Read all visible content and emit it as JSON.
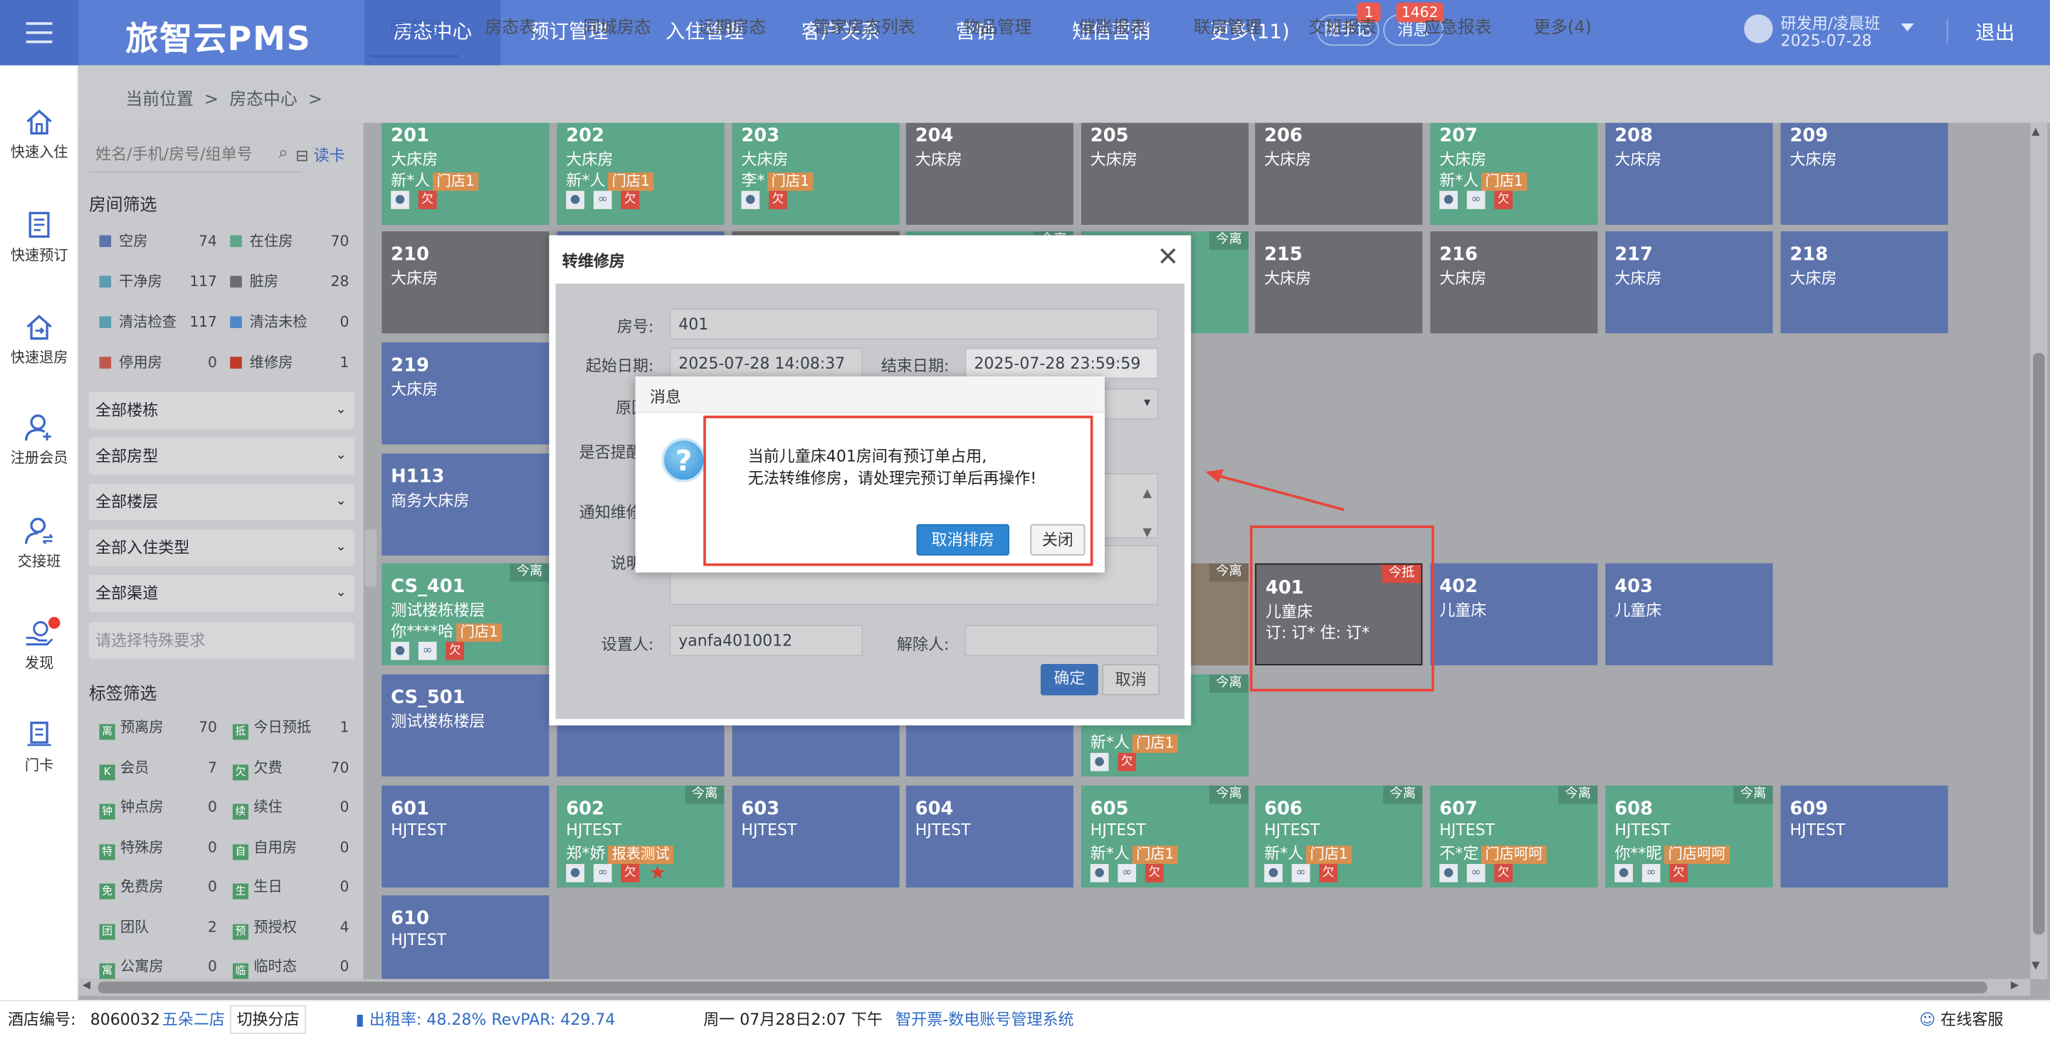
{
  "app": {
    "title": "旅智云PMS"
  },
  "topnav": {
    "items": [
      "房态中心",
      "预订管理",
      "入住管理",
      "客户关系",
      "营销",
      "短信营销",
      "更多(11)"
    ],
    "notes_label": "随手记",
    "notes_count": "1",
    "msg_label": "消息",
    "msg_count": "1462",
    "user_name": "研发用/凌晨班",
    "user_date": "2025-07-28",
    "logout": "退出"
  },
  "leftnav": [
    "快速入住",
    "快速预订",
    "快速退房",
    "注册会员",
    "交接班",
    "发现",
    "门卡"
  ],
  "breadcrumb": {
    "label": "当前位置",
    "sep": ">",
    "item": "房态中心",
    "sep2": ">"
  },
  "subtabs": [
    "房态图",
    "房态表",
    "同城房态",
    "远期房态",
    "管家房态列表",
    "物品管理",
    "催账报表",
    "联房管理",
    "交班报表",
    "应急报表",
    "更多(4)"
  ],
  "filter": {
    "search_placeholder": "姓名/手机/房号/组单号",
    "read_card": "读卡",
    "room_filter_title": "房间筛选",
    "status": [
      {
        "label": "空房",
        "count": "74",
        "color": "#5c73ac"
      },
      {
        "label": "在住房",
        "count": "70",
        "color": "#5ca689"
      },
      {
        "label": "干净房",
        "count": "117",
        "color": "#5c9bb0"
      },
      {
        "label": "脏房",
        "count": "28",
        "color": "#6b6d72"
      },
      {
        "label": "清洁检查",
        "count": "117",
        "color": "#5c9bb0"
      },
      {
        "label": "清洁未检",
        "count": "0",
        "color": "#4f86c6"
      },
      {
        "label": "停用房",
        "count": "0",
        "color": "#c0574e"
      },
      {
        "label": "维修房",
        "count": "1",
        "color": "#c0392b"
      }
    ],
    "dropdowns": [
      "全部楼栋",
      "全部房型",
      "全部楼层",
      "全部入住类型",
      "全部渠道"
    ],
    "special_placeholder": "请选择特殊要求",
    "tag_title": "标签筛选",
    "tags": [
      {
        "icon": "离",
        "label": "预离房",
        "count": "70"
      },
      {
        "icon": "抵",
        "label": "今日预抵",
        "count": "1"
      },
      {
        "icon": "K",
        "label": "会员",
        "count": "7"
      },
      {
        "icon": "欠",
        "label": "欠费",
        "count": "70"
      },
      {
        "icon": "钟",
        "label": "钟点房",
        "count": "0"
      },
      {
        "icon": "续",
        "label": "续住",
        "count": "0"
      },
      {
        "icon": "特",
        "label": "特殊房",
        "count": "0"
      },
      {
        "icon": "自",
        "label": "自用房",
        "count": "0"
      },
      {
        "icon": "免",
        "label": "免费房",
        "count": "0"
      },
      {
        "icon": "生",
        "label": "生日",
        "count": "0"
      },
      {
        "icon": "团",
        "label": "团队",
        "count": "2"
      },
      {
        "icon": "预",
        "label": "预授权",
        "count": "4"
      },
      {
        "icon": "寓",
        "label": "公寓房",
        "count": "0"
      },
      {
        "icon": "临",
        "label": "临时态",
        "count": "0"
      }
    ]
  },
  "rooms": [
    {
      "no": "201",
      "type": "大床房",
      "guest": "新*人",
      "store": "门店1",
      "color": "g",
      "icons": "p|o",
      "badge": ""
    },
    {
      "no": "202",
      "type": "大床房",
      "guest": "新*人",
      "store": "门店1",
      "color": "g",
      "icons": "p|l|o",
      "badge": ""
    },
    {
      "no": "203",
      "type": "大床房",
      "guest": "李*",
      "store": "门店1",
      "color": "g",
      "icons": "p|o",
      "badge": ""
    },
    {
      "no": "204",
      "type": "大床房",
      "guest": "",
      "store": "",
      "color": "d",
      "icons": "",
      "badge": ""
    },
    {
      "no": "205",
      "type": "大床房",
      "guest": "",
      "store": "",
      "color": "d",
      "icons": "",
      "badge": ""
    },
    {
      "no": "206",
      "type": "大床房",
      "guest": "",
      "store": "",
      "color": "d",
      "icons": "",
      "badge": ""
    },
    {
      "no": "207",
      "type": "大床房",
      "guest": "新*人",
      "store": "门店1",
      "color": "g",
      "icons": "p|l|o",
      "badge": ""
    },
    {
      "no": "208",
      "type": "大床房",
      "guest": "",
      "store": "",
      "color": "b",
      "icons": "",
      "badge": ""
    },
    {
      "no": "209",
      "type": "大床房",
      "guest": "",
      "store": "",
      "color": "b",
      "icons": "",
      "badge": ""
    },
    {
      "no": "210",
      "type": "大床房",
      "guest": "",
      "store": "",
      "color": "d",
      "icons": "",
      "badge": ""
    },
    {
      "no": "",
      "type": "",
      "guest": "",
      "store": "",
      "color": "b",
      "icons": "",
      "badge": ""
    },
    {
      "no": "",
      "type": "",
      "guest": "",
      "store": "",
      "color": "d",
      "icons": "",
      "badge": ""
    },
    {
      "no": "",
      "type": "",
      "guest": "",
      "store": "",
      "color": "g",
      "icons": "",
      "badge": "今离"
    },
    {
      "no": "",
      "type": "",
      "guest": "",
      "store": "",
      "color": "g",
      "icons": "",
      "badge": "今离"
    },
    {
      "no": "215",
      "type": "大床房",
      "guest": "",
      "store": "",
      "color": "d",
      "icons": "",
      "badge": ""
    },
    {
      "no": "216",
      "type": "大床房",
      "guest": "",
      "store": "",
      "color": "d",
      "icons": "",
      "badge": ""
    },
    {
      "no": "217",
      "type": "大床房",
      "guest": "",
      "store": "",
      "color": "b",
      "icons": "",
      "badge": ""
    },
    {
      "no": "218",
      "type": "大床房",
      "guest": "",
      "store": "",
      "color": "b",
      "icons": "",
      "badge": ""
    },
    {
      "no": "219",
      "type": "大床房",
      "guest": "",
      "store": "",
      "color": "b",
      "icons": "",
      "badge": ""
    },
    {
      "no": "H113",
      "type": "商务大床房",
      "guest": "",
      "store": "",
      "color": "b",
      "icons": "",
      "badge": ""
    },
    {
      "no": "CS_401",
      "type": "测试楼栋楼层",
      "guest": "你****哈",
      "store": "门店1",
      "color": "g",
      "icons": "p|l|o",
      "badge": "今离"
    },
    {
      "no": "",
      "type": "",
      "guest": "",
      "store": "",
      "color": "br",
      "icons": "",
      "badge": "今离"
    },
    {
      "no": "401",
      "type": "儿童床",
      "guest": "订: 订* 住: 订*",
      "store": "",
      "color": "d",
      "icons": "",
      "badge": "今抵"
    },
    {
      "no": "402",
      "type": "儿童床",
      "guest": "",
      "store": "",
      "color": "b",
      "icons": "",
      "badge": ""
    },
    {
      "no": "403",
      "type": "儿童床",
      "guest": "",
      "store": "",
      "color": "b",
      "icons": "",
      "badge": ""
    },
    {
      "no": "CS_501",
      "type": "测试楼栋楼层",
      "guest": "",
      "store": "",
      "color": "b",
      "icons": "",
      "badge": ""
    },
    {
      "no": "",
      "type": "",
      "guest": "",
      "store": "",
      "color": "b",
      "icons": "",
      "badge": ""
    },
    {
      "no": "",
      "type": "",
      "guest": "",
      "store": "",
      "color": "b",
      "icons": "",
      "badge": ""
    },
    {
      "no": "",
      "type": "",
      "guest": "",
      "store": "",
      "color": "b",
      "icons": "",
      "badge": ""
    },
    {
      "no": "",
      "type": "",
      "guest": "新*人",
      "store": "门店1",
      "color": "g",
      "icons": "p|o",
      "badge": "今离"
    },
    {
      "no": "601",
      "type": "HJTEST",
      "guest": "",
      "store": "",
      "color": "b",
      "icons": "",
      "badge": ""
    },
    {
      "no": "602",
      "type": "HJTEST",
      "guest": "郑*娇",
      "store": "报表测试",
      "color": "g",
      "icons": "p|l|o|s",
      "badge": "今离"
    },
    {
      "no": "603",
      "type": "HJTEST",
      "guest": "",
      "store": "",
      "color": "b",
      "icons": "",
      "badge": ""
    },
    {
      "no": "604",
      "type": "HJTEST",
      "guest": "",
      "store": "",
      "color": "b",
      "icons": "",
      "badge": ""
    },
    {
      "no": "605",
      "type": "HJTEST",
      "guest": "新*人",
      "store": "门店1",
      "color": "g",
      "icons": "p|l|o",
      "badge": "今离"
    },
    {
      "no": "606",
      "type": "HJTEST",
      "guest": "新*人",
      "store": "门店1",
      "color": "g",
      "icons": "p|l|o",
      "badge": "今离"
    },
    {
      "no": "607",
      "type": "HJTEST",
      "guest": "不*定",
      "store": "门店呵呵",
      "color": "g",
      "icons": "p|l|o",
      "badge": "今离"
    },
    {
      "no": "608",
      "type": "HJTEST",
      "guest": "你**昵",
      "store": "门店呵呵",
      "color": "g",
      "icons": "p|l|o",
      "badge": "今离"
    },
    {
      "no": "609",
      "type": "HJTEST",
      "guest": "",
      "store": "",
      "color": "b",
      "icons": "",
      "badge": ""
    },
    {
      "no": "610",
      "type": "HJTEST",
      "guest": "",
      "store": "",
      "color": "b",
      "icons": "",
      "badge": ""
    }
  ],
  "repair_dialog": {
    "title": "转维修房",
    "room_label": "房号:",
    "room_value": "401",
    "start_label": "起始日期:",
    "start_value": "2025-07-28 14:08:37",
    "end_label": "结束日期:",
    "end_value": "2025-07-28 23:59:59",
    "reason_label": "原因",
    "remind_label": "是否提醒",
    "notify_label": "通知维修",
    "note_label": "说明",
    "setter_label": "设置人:",
    "setter_value": "yanfa4010012",
    "clear_label": "解除人:",
    "clear_value": "",
    "ok": "确定",
    "cancel": "取消"
  },
  "message_dialog": {
    "title": "消息",
    "line1": "当前儿童床401房间有预订单占用,",
    "line2": "无法转维修房，请处理完预订单后再操作!",
    "primary": "取消排房",
    "close": "关闭"
  },
  "status_bar": {
    "hotel_label": "酒店编号:",
    "hotel_no": "8060032",
    "branch": "五朵二店",
    "switch": "切换分店",
    "occ": "出租率:  48.28% RevPAR:  429.74",
    "datetime": "周一 07月28日2:07 下午",
    "link": "智开票-数电账号管理系统",
    "service": "在线客服"
  }
}
